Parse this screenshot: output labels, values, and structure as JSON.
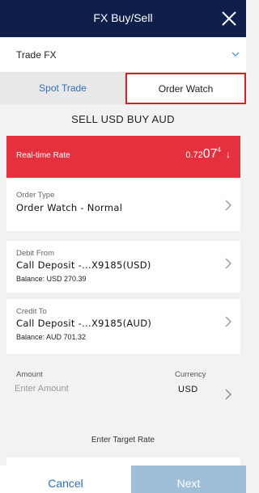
{
  "header": {
    "title": "FX Buy/Sell",
    "close_icon": "close-icon"
  },
  "trade_fx": {
    "label": "Trade FX",
    "icon": "chevron-down-icon"
  },
  "tabs": [
    {
      "label": "Spot Trade",
      "selected": false
    },
    {
      "label": "Order Watch",
      "selected": true
    }
  ],
  "pair_title": "SELL USD BUY AUD",
  "rate": {
    "label": "Real-time Rate",
    "prefix": "0.72",
    "main": "07",
    "superscript": "4",
    "trend_icon": "arrow-down-icon",
    "color": "#e5303e"
  },
  "order_type": {
    "label": "Order Type",
    "value": "Order Watch - Normal"
  },
  "debit": {
    "label": "Debit From",
    "account": "Call Deposit -...X9185(USD)",
    "balance": "Balance: USD 270.39"
  },
  "credit": {
    "label": "Credit To",
    "account": "Call Deposit -...X9185(AUD)",
    "balance": "Balance: AUD 701.32"
  },
  "amount": {
    "label": "Amount",
    "placeholder": "Enter Amount",
    "currency_label": "Currency",
    "currency_value": "USD"
  },
  "target_rate_label": "Enter Target Rate",
  "footer": {
    "cancel_label": "Cancel",
    "next_label": "Next"
  },
  "colors": {
    "header_bg": "#0f1f4b",
    "accent_blue": "#2f6fb8",
    "tab_highlight": "#d81f2a",
    "next_disabled": "#9fbfd9"
  }
}
